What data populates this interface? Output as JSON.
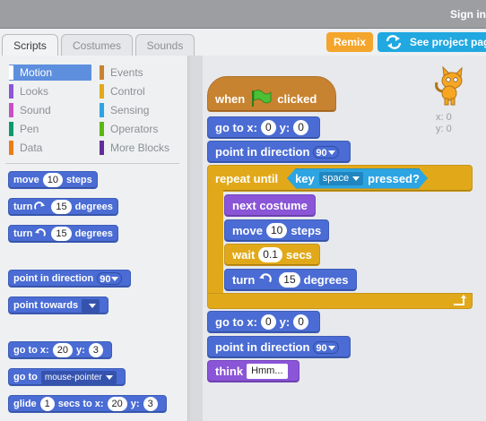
{
  "topbar": {
    "signin": "Sign in"
  },
  "tabs": [
    {
      "label": "Scripts"
    },
    {
      "label": "Costumes"
    },
    {
      "label": "Sounds"
    }
  ],
  "buttons": {
    "remix": "Remix",
    "see_project": "See project page"
  },
  "categories": {
    "motion": "Motion",
    "looks": "Looks",
    "sound": "Sound",
    "pen": "Pen",
    "data": "Data",
    "events": "Events",
    "control": "Control",
    "sensing": "Sensing",
    "operators": "Operators",
    "more": "More Blocks"
  },
  "colors": {
    "motion": "#4a6cd4",
    "looks": "#8a55d7",
    "sound": "#c94fc7",
    "pen": "#0e9a6c",
    "data": "#ee7d16",
    "events": "#c88330",
    "control": "#e1a91a",
    "sensing": "#2ca5e2",
    "operators": "#5cb712",
    "more": "#632d99"
  },
  "palette": {
    "move": {
      "a": "move",
      "n": "10",
      "b": "steps"
    },
    "turn_cw": {
      "a": "turn",
      "icon": "rotate-right-icon",
      "n": "15",
      "b": "degrees"
    },
    "turn_ccw": {
      "a": "turn",
      "icon": "rotate-left-icon",
      "n": "15",
      "b": "degrees"
    },
    "point_dir": {
      "a": "point in direction",
      "n": "90"
    },
    "point_towards": {
      "a": "point towards"
    },
    "goto_xy": {
      "a": "go to x:",
      "x": "20",
      "b": "y:",
      "y": "3"
    },
    "goto": {
      "a": "go to",
      "v": "mouse-pointer"
    },
    "glide": {
      "a": "glide",
      "n": "1",
      "b": "secs to x:",
      "x": "20",
      "c": "y:",
      "y": "3"
    }
  },
  "script": {
    "when_flag": {
      "a": "when",
      "b": "clicked"
    },
    "goto1": {
      "a": "go to x:",
      "x": "0",
      "b": "y:",
      "y": "0"
    },
    "point1": {
      "a": "point in direction",
      "n": "90"
    },
    "repeat": {
      "a": "repeat until",
      "key": "key",
      "key_value": "space",
      "pressed": "pressed?"
    },
    "next_costume": "next costume",
    "move": {
      "a": "move",
      "n": "10",
      "b": "steps"
    },
    "wait": {
      "a": "wait",
      "n": "0.1",
      "b": "secs"
    },
    "turn": {
      "a": "turn",
      "n": "15",
      "b": "degrees"
    },
    "goto2": {
      "a": "go to x:",
      "x": "0",
      "b": "y:",
      "y": "0"
    },
    "point2": {
      "a": "point in direction",
      "n": "90"
    },
    "think": {
      "a": "think",
      "v": "Hmm..."
    }
  },
  "sprite_info": {
    "x": "x: 0",
    "y": "y: 0"
  }
}
